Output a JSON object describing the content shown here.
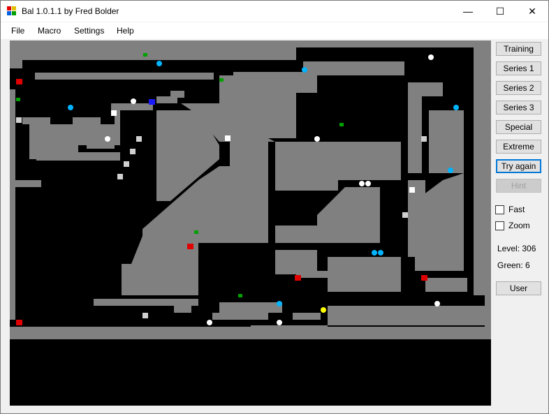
{
  "window": {
    "title": "Bal 1.0.1.1 by Fred Bolder",
    "minimize_glyph": "—",
    "maximize_glyph": "☐",
    "close_glyph": "✕"
  },
  "menu": {
    "file": "File",
    "macro": "Macro",
    "settings": "Settings",
    "help": "Help"
  },
  "side_panel": {
    "training": "Training",
    "series1": "Series 1",
    "series2": "Series 2",
    "series3": "Series 3",
    "special": "Special",
    "extreme": "Extreme",
    "try_again": "Try again",
    "hint": "Hint",
    "fast": "Fast",
    "zoom": "Zoom",
    "level": "Level: 306",
    "green": "Green: 6",
    "user": "User"
  },
  "colors": {
    "wall": "#808080",
    "floor": "#000000",
    "ball_cyan": "#00b4ff",
    "ball_white": "#ffffff",
    "ball_blue": "#1a1aff",
    "ball_yellow": "#ffff00",
    "marker_red": "#e00000",
    "marker_green": "#00a000"
  },
  "pieces": [
    {
      "kind": "cyan-ball"
    },
    {
      "kind": "cyan-ball"
    },
    {
      "kind": "cyan-ball"
    },
    {
      "kind": "cyan-ball"
    },
    {
      "kind": "cyan-ball"
    },
    {
      "kind": "cyan-ball"
    },
    {
      "kind": "cyan-ball"
    },
    {
      "kind": "cyan-ball"
    },
    {
      "kind": "white-ball"
    },
    {
      "kind": "white-ball"
    },
    {
      "kind": "white-ball"
    },
    {
      "kind": "white-ball"
    },
    {
      "kind": "white-ball"
    },
    {
      "kind": "white-ball"
    },
    {
      "kind": "white-ball"
    },
    {
      "kind": "white-ball"
    },
    {
      "kind": "white-ball"
    },
    {
      "kind": "yellow-ball"
    },
    {
      "kind": "blue-ball"
    },
    {
      "kind": "red-marker"
    },
    {
      "kind": "red-marker"
    },
    {
      "kind": "red-marker"
    },
    {
      "kind": "red-marker"
    },
    {
      "kind": "red-marker"
    },
    {
      "kind": "green-marker"
    },
    {
      "kind": "green-marker"
    },
    {
      "kind": "green-marker"
    },
    {
      "kind": "green-marker"
    },
    {
      "kind": "green-marker"
    },
    {
      "kind": "green-marker"
    }
  ]
}
